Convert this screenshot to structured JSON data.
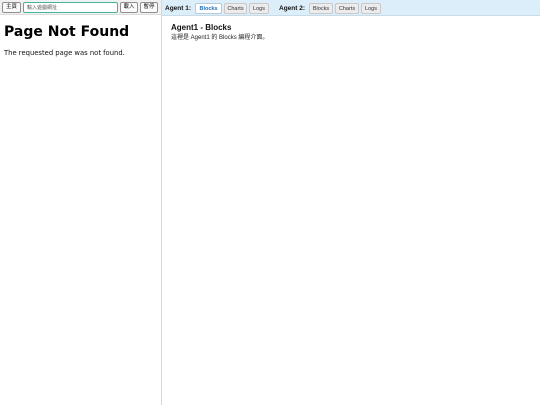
{
  "toolbar": {
    "home_label": "主頁",
    "url_placeholder": "輸入遊戲網址",
    "load_label": "載入",
    "pause_label": "暫停"
  },
  "left_page": {
    "title": "Page Not Found",
    "message": "The requested page was not found."
  },
  "agents": [
    {
      "label": "Agent 1:",
      "tabs": [
        "Blocks",
        "Charts",
        "Logs"
      ],
      "active_tab": "Blocks"
    },
    {
      "label": "Agent 2:",
      "tabs": [
        "Blocks",
        "Charts",
        "Logs"
      ]
    }
  ],
  "content": {
    "title": "Agent1 - Blocks",
    "description": "這裡是 Agent1 的 Blocks 編程介面。"
  },
  "colors": {
    "tabbar_bg": "#dbeefa",
    "active_tab_text": "#1f6fc1",
    "url_border": "#46b29d"
  }
}
